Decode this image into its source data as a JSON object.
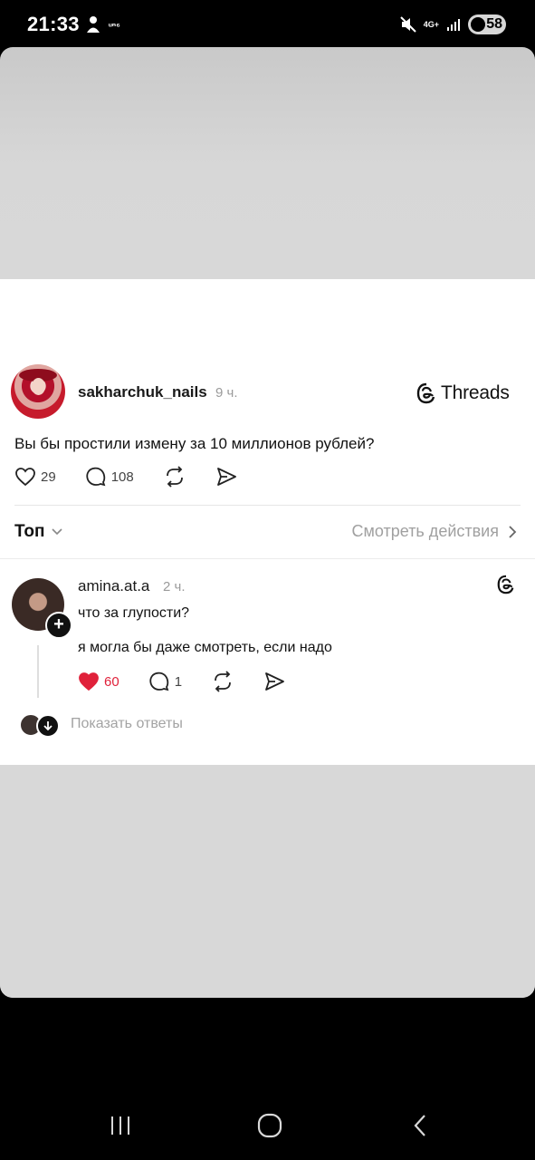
{
  "status_bar": {
    "time": "21:33",
    "small_label": "ᵤₙ₆",
    "network": "4G+",
    "battery": "58"
  },
  "post": {
    "username": "sakharchuk_nails",
    "time": "9 ч.",
    "brand": "Threads",
    "text": "Вы бы простили измену за 10 миллионов рублей?",
    "likes": "29",
    "comments": "108"
  },
  "sort": {
    "label": "Топ",
    "view_actions": "Смотреть действия"
  },
  "reply": {
    "username": "amina.at.a",
    "time": "2 ч.",
    "text_1": "что за глупости?",
    "text_2": "я могла бы даже смотреть, если надо",
    "likes": "60",
    "comments": "1",
    "like_color": "#e0213a"
  },
  "show_replies": "Показать ответы",
  "icons": {
    "like": "heart-icon",
    "comment": "comment-icon",
    "repost": "repost-icon",
    "share": "send-icon",
    "threads": "threads-logo-icon"
  }
}
